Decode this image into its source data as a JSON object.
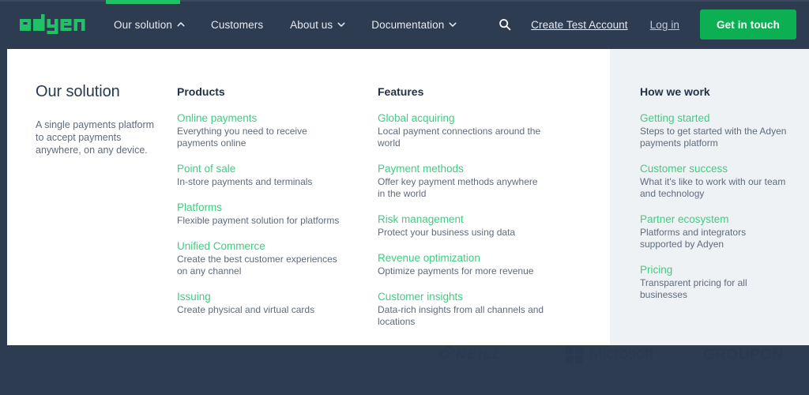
{
  "brand": {
    "logo_text": "adyen",
    "logo_color": "#21c168"
  },
  "colors": {
    "header_bg": "#2e3c52",
    "link_green": "#3ecd82",
    "cta_green": "#0caf52",
    "panel_white": "#ffffff",
    "panel_gray": "#eff2f5",
    "body_text": "#5f6b7c",
    "heading_text": "#233246"
  },
  "header": {
    "nav": [
      {
        "label": "Our solution",
        "icon": "chevron-up-icon",
        "active": true
      },
      {
        "label": "Customers",
        "icon": "",
        "active": false
      },
      {
        "label": "About us",
        "icon": "chevron-down-icon",
        "active": false
      },
      {
        "label": "Documentation",
        "icon": "chevron-down-icon",
        "active": false
      }
    ],
    "search_icon": "search-icon",
    "create_account_label": "Create Test Account",
    "login_label": "Log in",
    "cta_label": "Get in touch"
  },
  "dropdown": {
    "intro": {
      "title": "Our solution",
      "description": "A single payments platform to accept payments anywhere, on any device."
    },
    "products": {
      "heading": "Products",
      "items": [
        {
          "title": "Online payments",
          "desc": "Everything you need to receive payments online"
        },
        {
          "title": "Point of sale",
          "desc": "In-store payments and terminals"
        },
        {
          "title": "Platforms",
          "desc": "Flexible payment solution for platforms"
        },
        {
          "title": "Unified Commerce",
          "desc": "Create the best customer experiences on any channel"
        },
        {
          "title": "Issuing",
          "desc": "Create physical and virtual cards"
        }
      ]
    },
    "features": {
      "heading": "Features",
      "items": [
        {
          "title": "Global acquiring",
          "desc": "Local payment connections around the world"
        },
        {
          "title": "Payment methods",
          "desc": "Offer key payment methods anywhere in the world"
        },
        {
          "title": "Risk management",
          "desc": "Protect your business using data"
        },
        {
          "title": "Revenue optimization",
          "desc": "Optimize payments for more revenue"
        },
        {
          "title": "Customer insights",
          "desc": "Data-rich insights from all channels and locations"
        }
      ]
    },
    "how_we_work": {
      "heading": "How we work",
      "items": [
        {
          "title": "Getting started",
          "desc": "Steps to get started with the Adyen payments platform"
        },
        {
          "title": "Customer success",
          "desc": "What it's like to work with our team and technology"
        },
        {
          "title": "Partner ecosystem",
          "desc": "Platforms and integrators supported by Adyen"
        },
        {
          "title": "Pricing",
          "desc": "Transparent pricing for all businesses"
        }
      ]
    }
  },
  "logo_strip": {
    "brands": [
      {
        "name": "O'NEILL"
      },
      {
        "name": "Microsoft"
      },
      {
        "name": "GROUPON"
      }
    ]
  }
}
